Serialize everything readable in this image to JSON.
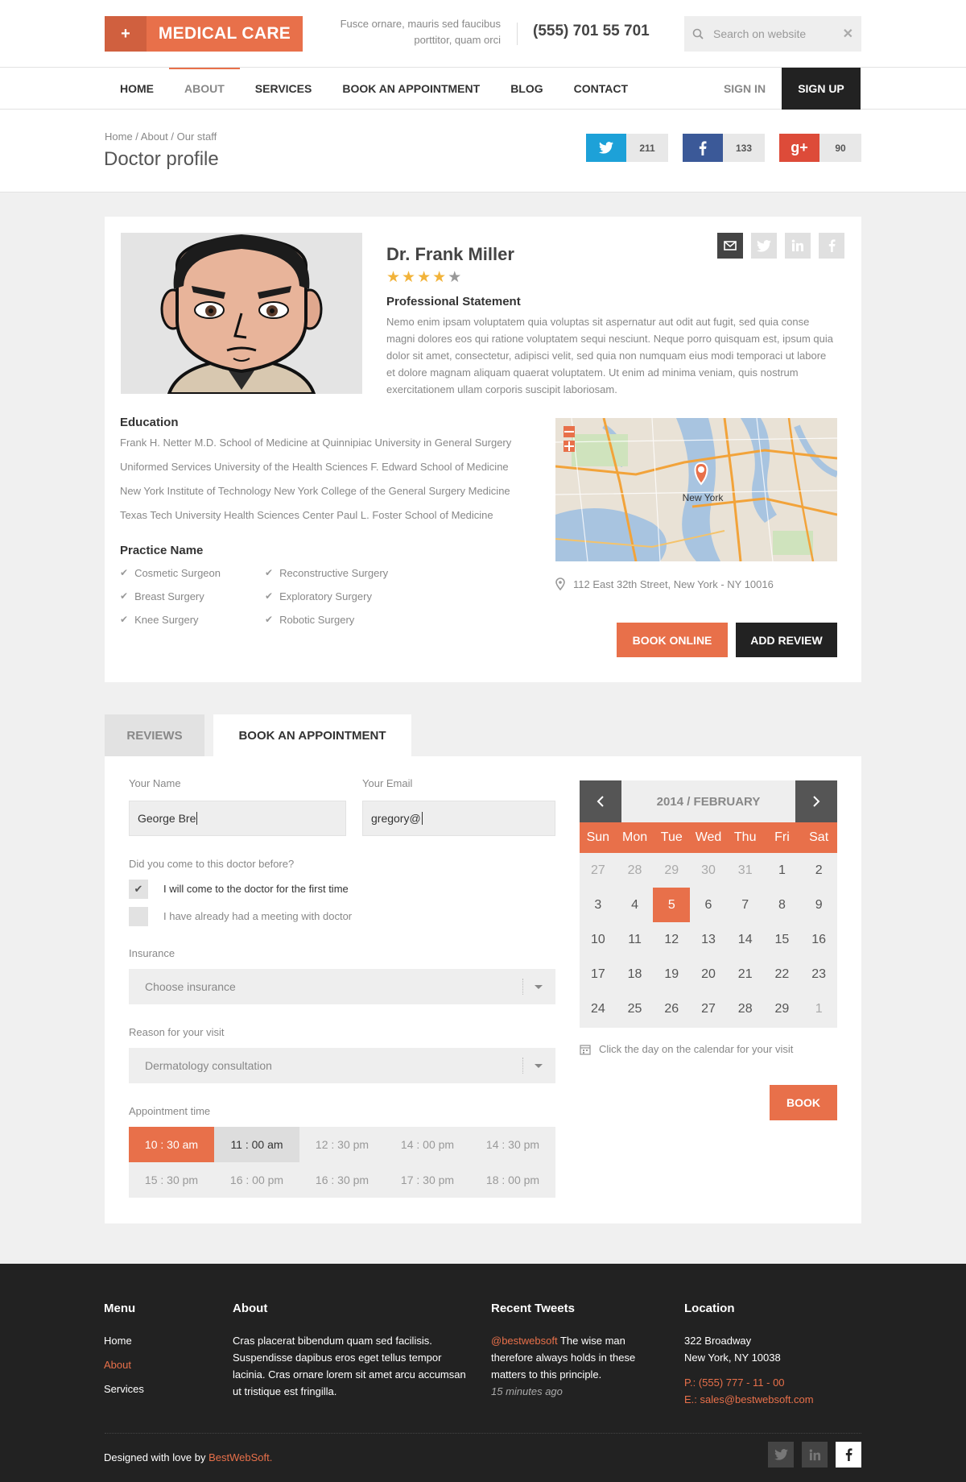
{
  "header": {
    "logo_text": "MEDICAL CARE",
    "tagline": "Fusce ornare, mauris sed faucibus porttitor, quam orci",
    "phone": "(555) 701 55 701",
    "search_placeholder": "Search on website"
  },
  "nav": {
    "items": [
      {
        "label": "HOME",
        "active": false
      },
      {
        "label": "ABOUT",
        "active": true
      },
      {
        "label": "SERVICES",
        "active": false
      },
      {
        "label": "BOOK AN APPOINTMENT",
        "active": false
      },
      {
        "label": "BLOG",
        "active": false
      },
      {
        "label": "CONTACT",
        "active": false
      }
    ],
    "signin": "SIGN IN",
    "signup": "SIGN UP"
  },
  "titlebar": {
    "breadcrumb": "Home / About / Our staff",
    "title": "Doctor profile",
    "shares": [
      {
        "network": "twitter",
        "count": "211",
        "color": "#1da1d8"
      },
      {
        "network": "facebook",
        "count": "133",
        "color": "#3b5998"
      },
      {
        "network": "google-plus",
        "count": "90",
        "color": "#dd4b39"
      }
    ]
  },
  "doctor": {
    "name": "Dr. Frank Miller",
    "rating": 4,
    "rating_max": 5,
    "statement_title": "Professional Statement",
    "statement": "Nemo enim ipsam voluptatem quia voluptas sit aspernatur aut odit aut fugit, sed quia conse magni dolores eos qui ratione voluptatem sequi nesciunt. Neque porro quisquam est, ipsum quia dolor sit amet, consectetur, adipisci velit, sed quia non numquam eius modi temporaci ut labore et dolore magnam aliquam quaerat voluptatem. Ut enim ad minima veniam, quis nostrum exercitationem ullam corporis suscipit laboriosam.",
    "education_title": "Education",
    "education": [
      "Frank H. Netter M.D. School of Medicine at Quinnipiac University in General Surgery",
      "Uniformed Services University of the Health Sciences F. Edward School of Medicine",
      "New York Institute of Technology New York College of the General Surgery Medicine",
      "Texas Tech University Health Sciences Center Paul L. Foster School of Medicine"
    ],
    "practice_title": "Practice Name",
    "practice": [
      "Cosmetic Surgeon",
      "Reconstructive Surgery",
      "Breast Surgery",
      "Exploratory Surgery",
      "Knee Surgery",
      "Robotic Surgery"
    ],
    "map_label": "New York",
    "address": "112 East 32th Street, New York -  NY 10016",
    "book_online": "BOOK ONLINE",
    "add_review": "ADD REVIEW"
  },
  "tabs": [
    "REVIEWS",
    "BOOK AN APPOINTMENT"
  ],
  "form": {
    "name_label": "Your Name",
    "name_value": "George Bre",
    "email_label": "Your Email",
    "email_value": "gregory@",
    "visited_label": "Did you come to this doctor before?",
    "options": [
      {
        "label": "I will come to the doctor for the first time",
        "checked": true
      },
      {
        "label": "I have already had a meeting with doctor",
        "checked": false
      }
    ],
    "insurance_label": "Insurance",
    "insurance_value": "Choose insurance",
    "reason_label": "Reason for your visit",
    "reason_value": "Dermatology consultation",
    "time_label": "Appointment time",
    "times": [
      "10 : 30 am",
      "11 : 00 am",
      "12 : 30 pm",
      "14 : 00 pm",
      "14 : 30 pm",
      "15 : 30 pm",
      "16 : 00 pm",
      "16 : 30 pm",
      "17 : 30 pm",
      "18 : 00 pm"
    ],
    "selected_time": "10 : 30 am",
    "hovered_time": "11 : 00 am"
  },
  "calendar": {
    "month": "2014 / FEBRUARY",
    "weekdays": [
      "Sun",
      "Mon",
      "Tue",
      "Wed",
      "Thu",
      "Fri",
      "Sat"
    ],
    "days": [
      {
        "d": "27",
        "out": true
      },
      {
        "d": "28",
        "out": true
      },
      {
        "d": "29",
        "out": true
      },
      {
        "d": "30",
        "out": true
      },
      {
        "d": "31",
        "out": true
      },
      {
        "d": "1"
      },
      {
        "d": "2"
      },
      {
        "d": "3"
      },
      {
        "d": "4"
      },
      {
        "d": "5",
        "selected": true
      },
      {
        "d": "6"
      },
      {
        "d": "7"
      },
      {
        "d": "8"
      },
      {
        "d": "9"
      },
      {
        "d": "10"
      },
      {
        "d": "11"
      },
      {
        "d": "12"
      },
      {
        "d": "13"
      },
      {
        "d": "14"
      },
      {
        "d": "15"
      },
      {
        "d": "16"
      },
      {
        "d": "17"
      },
      {
        "d": "18"
      },
      {
        "d": "19"
      },
      {
        "d": "20"
      },
      {
        "d": "21"
      },
      {
        "d": "22"
      },
      {
        "d": "23"
      },
      {
        "d": "24"
      },
      {
        "d": "25"
      },
      {
        "d": "26"
      },
      {
        "d": "27"
      },
      {
        "d": "28"
      },
      {
        "d": "29"
      },
      {
        "d": "1",
        "out": true
      }
    ],
    "note": "Click the day on the calendar for your visit",
    "book": "BOOK"
  },
  "footer": {
    "menu_title": "Menu",
    "menu": [
      {
        "label": "Home",
        "active": false
      },
      {
        "label": "About",
        "active": true
      },
      {
        "label": "Services",
        "active": false
      }
    ],
    "about_title": "About",
    "about_text": "Cras placerat bibendum quam sed facilisis. Suspendisse dapibus eros eget tellus tempor lacinia. Cras ornare lorem sit amet arcu accumsan ut tristique est fringilla.",
    "tweets_title": "Recent Tweets",
    "tweet_handle": "@bestwebsoft",
    "tweet_text": " The wise man therefore always holds in these matters to this principle.",
    "tweet_time": "15 minutes ago",
    "location_title": "Location",
    "address_line1": "322 Broadway",
    "address_line2": "New York, NY 10038",
    "phone": "P.: (555) 777 - 11 - 00",
    "email": "E.: sales@bestwebsoft.com",
    "copyright_prefix": "Designed with love by ",
    "copyright_link": "BestWebSoft."
  },
  "colors": {
    "accent": "#e8704a",
    "dark": "#222222",
    "panel": "#eeeeee"
  }
}
